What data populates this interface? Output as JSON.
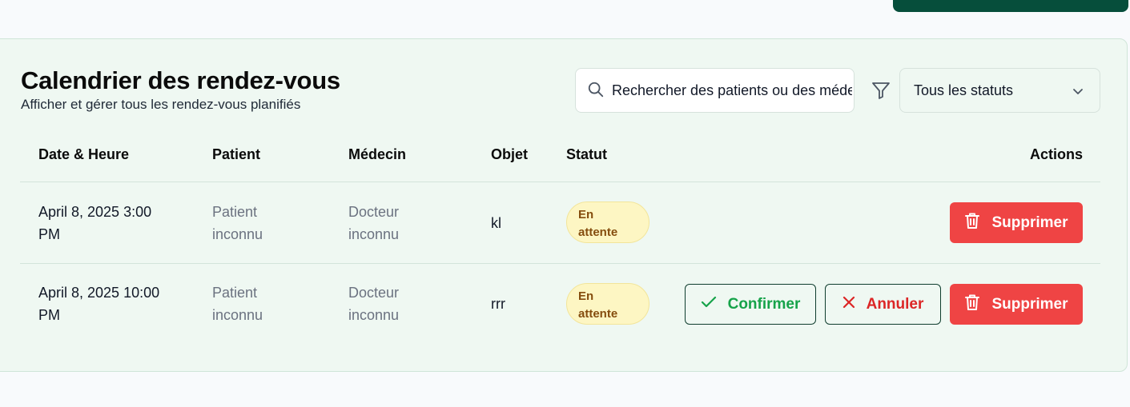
{
  "header": {
    "title": "Calendrier des rendez-vous",
    "subtitle": "Afficher et gérer tous les rendez-vous planifiés"
  },
  "search": {
    "placeholder": "Rechercher des patients ou des médecins"
  },
  "filter": {
    "selected": "Tous les statuts"
  },
  "table": {
    "columns": [
      "Date & Heure",
      "Patient",
      "Médecin",
      "Objet",
      "Statut",
      "Actions"
    ],
    "rows": [
      {
        "date_line1": "April 8, 2025 3:00",
        "date_line2": "PM",
        "patient_line1": "Patient",
        "patient_line2": "inconnu",
        "doctor_line1": "Docteur",
        "doctor_line2": "inconnu",
        "object": "kl",
        "status_line1": "En",
        "status_line2": "attente",
        "actions": {
          "delete": "Supprimer"
        }
      },
      {
        "date_line1": "April 8, 2025 10:00",
        "date_line2": "PM",
        "patient_line1": "Patient",
        "patient_line2": "inconnu",
        "doctor_line1": "Docteur",
        "doctor_line2": "inconnu",
        "object": "rrr",
        "status_line1": "En",
        "status_line2": "attente",
        "actions": {
          "confirm": "Confirmer",
          "cancel": "Annuler",
          "delete": "Supprimer"
        }
      }
    ]
  },
  "colors": {
    "primary_dark": "#064e3b",
    "card_bg": "#eff8f2",
    "danger": "#ef4444",
    "success": "#16a34a",
    "badge_bg": "#fdf6c3",
    "badge_text": "#854d0e"
  },
  "icons": [
    "search-icon",
    "filter-icon",
    "chevron-down-icon",
    "trash-icon",
    "check-icon",
    "x-icon"
  ]
}
